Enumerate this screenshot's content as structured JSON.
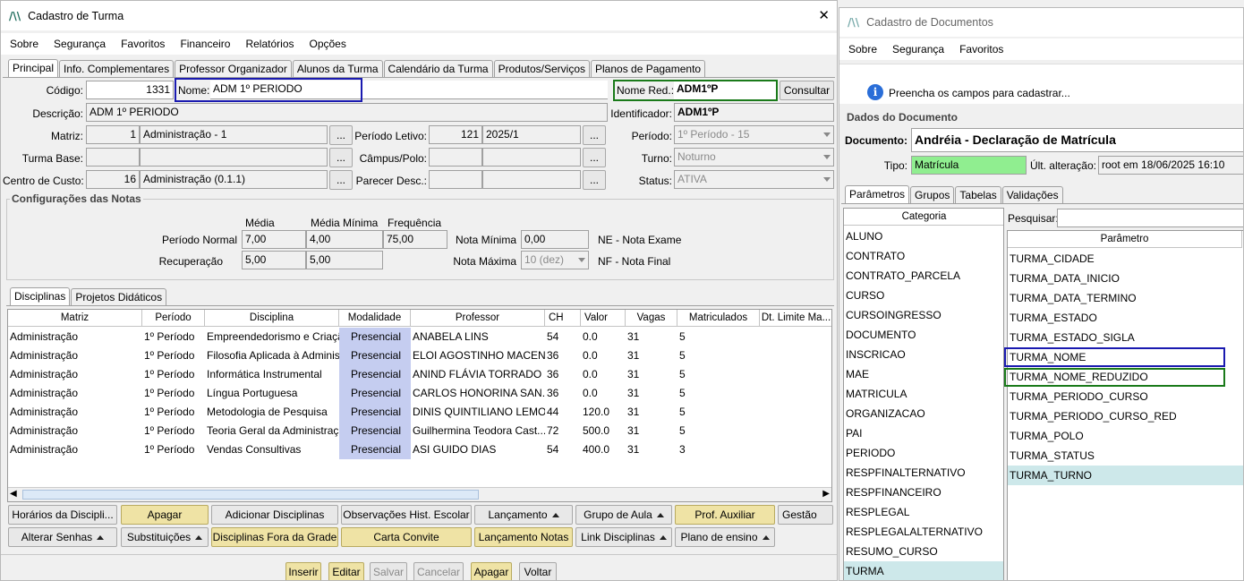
{
  "left": {
    "title": "Cadastro de Turma",
    "menu": [
      "Sobre",
      "Segurança",
      "Favoritos",
      "Financeiro",
      "Relatórios",
      "Opções"
    ],
    "tabs": [
      "Principal",
      "Info. Complementares",
      "Professor Organizador",
      "Alunos da Turma",
      "Calendário da Turma",
      "Produtos/Serviços",
      "Planos de Pagamento"
    ],
    "form": {
      "codigo_label": "Código:",
      "codigo": "1331",
      "nome_label": "Nome:",
      "nome": "ADM 1º PERIODO",
      "nome_red_label": "Nome Red.:",
      "nome_red": "ADM1ºP",
      "consultar": "Consultar",
      "descricao_label": "Descrição:",
      "descricao": "ADM 1º PERIODO",
      "identificador_label": "Identificador:",
      "identificador": "ADM1ºP",
      "matriz_label": "Matriz:",
      "matriz_id": "1",
      "matriz": "Administração - 1",
      "periodo_letivo_label": "Período Letivo:",
      "periodo_letivo_id": "121",
      "periodo_letivo": "2025/1",
      "periodo_label": "Período:",
      "periodo": "1º Período - 15",
      "turma_base_label": "Turma Base:",
      "campus_label": "Câmpus/Polo:",
      "turno_label": "Turno:",
      "turno": "Noturno",
      "centro_label": "Centro de Custo:",
      "centro_id": "16",
      "centro": "Administração (0.1.1)",
      "parecer_label": "Parecer Desc.:",
      "status_label": "Status:",
      "status": "ATIVA",
      "ellipsis": "..."
    },
    "notas": {
      "title": "Configurações das Notas",
      "media_h": "Média",
      "media_min_h": "Média Mínima",
      "freq_h": "Frequência",
      "normal_label": "Período Normal",
      "normal_media": "7,00",
      "normal_min": "4,00",
      "normal_freq": "75,00",
      "rec_label": "Recuperação",
      "rec_media": "5,00",
      "rec_min": "5,00",
      "nota_min_label": "Nota Mínima",
      "nota_min": "0,00",
      "nota_max_label": "Nota Máxima",
      "nota_max": "10 (dez)",
      "ne": "NE - Nota Exame",
      "nf": "NF - Nota Final"
    },
    "subtabs": [
      "Disciplinas",
      "Projetos Didáticos"
    ],
    "columns": [
      "Matriz",
      "Período",
      "Disciplina",
      "Modalidade",
      "Professor",
      "CH",
      "Valor",
      "Vagas",
      "Matriculados",
      "Dt. Limite Ma..."
    ],
    "rows": [
      [
        "Administração",
        "1º Período",
        "Empreendedorismo e Criação",
        "Presencial",
        "ANABELA LINS",
        "54",
        "0.0",
        "31",
        "5"
      ],
      [
        "Administração",
        "1º Período",
        "Filosofia Aplicada à Administração",
        "Presencial",
        "ELOI AGOSTINHO MACENA",
        "36",
        "0.0",
        "31",
        "5"
      ],
      [
        "Administração",
        "1º Período",
        "Informática Instrumental",
        "Presencial",
        "ANIND FLÁVIA TORRADO",
        "36",
        "0.0",
        "31",
        "5"
      ],
      [
        "Administração",
        "1º Período",
        "Língua Portuguesa",
        "Presencial",
        "CARLOS HONORINA SAN...",
        "36",
        "0.0",
        "31",
        "5"
      ],
      [
        "Administração",
        "1º Período",
        "Metodologia de Pesquisa",
        "Presencial",
        "DINIS QUINTILIANO LEMOS",
        "44",
        "120.0",
        "31",
        "5"
      ],
      [
        "Administração",
        "1º Período",
        "Teoria Geral da Administração",
        "Presencial",
        "Guilhermina Teodora Cast...",
        "72",
        "500.0",
        "31",
        "5"
      ],
      [
        "Administração",
        "1º Período",
        "Vendas Consultivas",
        "Presencial",
        "ASI GUIDO DIAS",
        "54",
        "400.0",
        "31",
        "3"
      ]
    ],
    "buttons_row1": [
      "Horários da Discipli...",
      "Apagar",
      "Adicionar Disciplinas",
      "Observações Hist. Escolar",
      "Lançamento",
      "Grupo de Aula",
      "Prof. Auxiliar",
      "Gestão"
    ],
    "buttons_row2": [
      "Alterar Senhas",
      "Substituições",
      "Disciplinas Fora da Grade",
      "Carta Convite",
      "Lançamento Notas",
      "Link Disciplinas",
      "Plano de ensino"
    ],
    "footer": [
      "Inserir",
      "Editar",
      "Salvar",
      "Cancelar",
      "Apagar",
      "Voltar"
    ]
  },
  "right": {
    "title": "Cadastro de Documentos",
    "menu": [
      "Sobre",
      "Segurança",
      "Favoritos"
    ],
    "info": "Preencha os campos para cadastrar...",
    "section": "Dados do Documento",
    "documento_label": "Documento:",
    "documento": "Andréia - Declaração de Matrícula",
    "tipo_label": "Tipo:",
    "tipo": "Matrícula",
    "ult_label": "Últ. alteração:",
    "ult": "root em 18/06/2025 16:10",
    "tabs": [
      "Parâmetros",
      "Grupos",
      "Tabelas",
      "Validações"
    ],
    "cat_header": "Categoria",
    "categories": [
      "ALUNO",
      "CONTRATO",
      "CONTRATO_PARCELA",
      "CURSO",
      "CURSOINGRESSO",
      "DOCUMENTO",
      "INSCRICAO",
      "MAE",
      "MATRICULA",
      "ORGANIZACAO",
      "PAI",
      "PERIODO",
      "RESPFINALTERNATIVO",
      "RESPFINANCEIRO",
      "RESPLEGAL",
      "RESPLEGALALTERNATIVO",
      "RESUMO_CURSO",
      "TURMA"
    ],
    "search_label": "Pesquisar:",
    "param_header": "Parâmetro",
    "params": [
      "TURMA_CIDADE",
      "TURMA_DATA_INICIO",
      "TURMA_DATA_TERMINO",
      "TURMA_ESTADO",
      "TURMA_ESTADO_SIGLA",
      "TURMA_NOME",
      "TURMA_NOME_REDUZIDO",
      "TURMA_PERIODO_CURSO",
      "TURMA_PERIODO_CURSO_RED",
      "TURMA_POLO",
      "TURMA_STATUS",
      "TURMA_TURNO"
    ]
  },
  "colors": {
    "highlight_blue": "#1a1ab0",
    "highlight_green": "#1a7a1a",
    "yellow_button": "#efe3a5",
    "modality": "#c5cdf0",
    "selected": "#cde8ea",
    "tipo_bg": "#90ee90"
  }
}
